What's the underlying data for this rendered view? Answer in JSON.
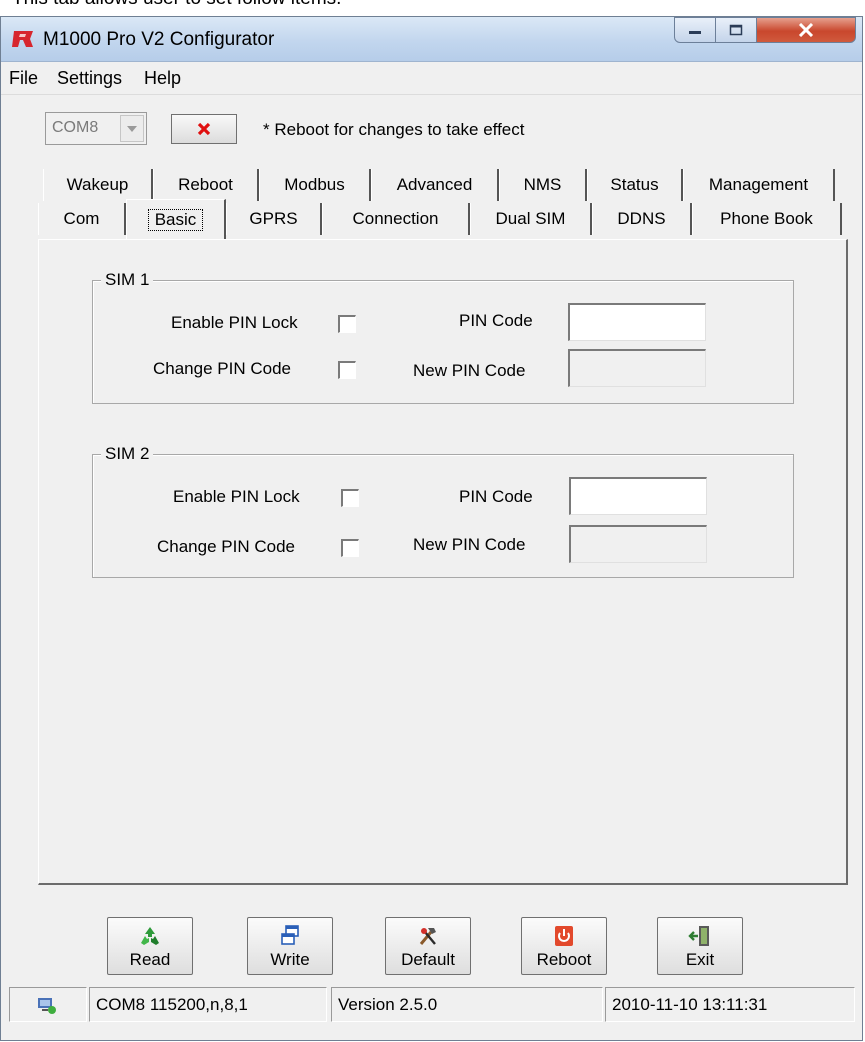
{
  "caption": "This tab allows user to set follow items.",
  "window": {
    "title": "M1000 Pro V2 Configurator",
    "controls": {
      "minimize": "minimize-icon",
      "maximize": "maximize-icon",
      "close": "close-icon"
    }
  },
  "menu": [
    "File",
    "Settings",
    "Help"
  ],
  "toolbar": {
    "com_port": "COM8",
    "close_port_icon": "red-x-icon",
    "notice": "* Reboot for changes to take effect"
  },
  "tabs": {
    "row_back": [
      "Wakeup",
      "Reboot",
      "Modbus",
      "Advanced",
      "NMS",
      "Status",
      "Management"
    ],
    "row_front": [
      "Com",
      "Basic",
      "GPRS",
      "Connection",
      "Dual SIM",
      "DDNS",
      "Phone Book"
    ],
    "active": "Basic"
  },
  "sim1": {
    "legend": "SIM 1",
    "enable_pin_lock_label": "Enable PIN Lock",
    "enable_pin_lock_checked": false,
    "change_pin_label": "Change PIN Code",
    "change_pin_checked": false,
    "pin_code_label": "PIN Code",
    "pin_code_value": "",
    "new_pin_label": "New PIN Code",
    "new_pin_value": ""
  },
  "sim2": {
    "legend": "SIM 2",
    "enable_pin_lock_label": "Enable PIN Lock",
    "enable_pin_lock_checked": false,
    "change_pin_label": "Change PIN Code",
    "change_pin_checked": false,
    "pin_code_label": "PIN Code",
    "pin_code_value": "",
    "new_pin_label": "New PIN Code",
    "new_pin_value": ""
  },
  "buttons": {
    "read": "Read",
    "write": "Write",
    "default": "Default",
    "reboot": "Reboot",
    "exit": "Exit"
  },
  "status": {
    "port": "COM8 115200,n,8,1",
    "version": "Version 2.5.0",
    "datetime": "2010-11-10 13:11:31"
  },
  "colors": {
    "titlebar": "#c2d6ee",
    "close_button": "#c9472d",
    "window_bg": "#f0f0f0"
  }
}
